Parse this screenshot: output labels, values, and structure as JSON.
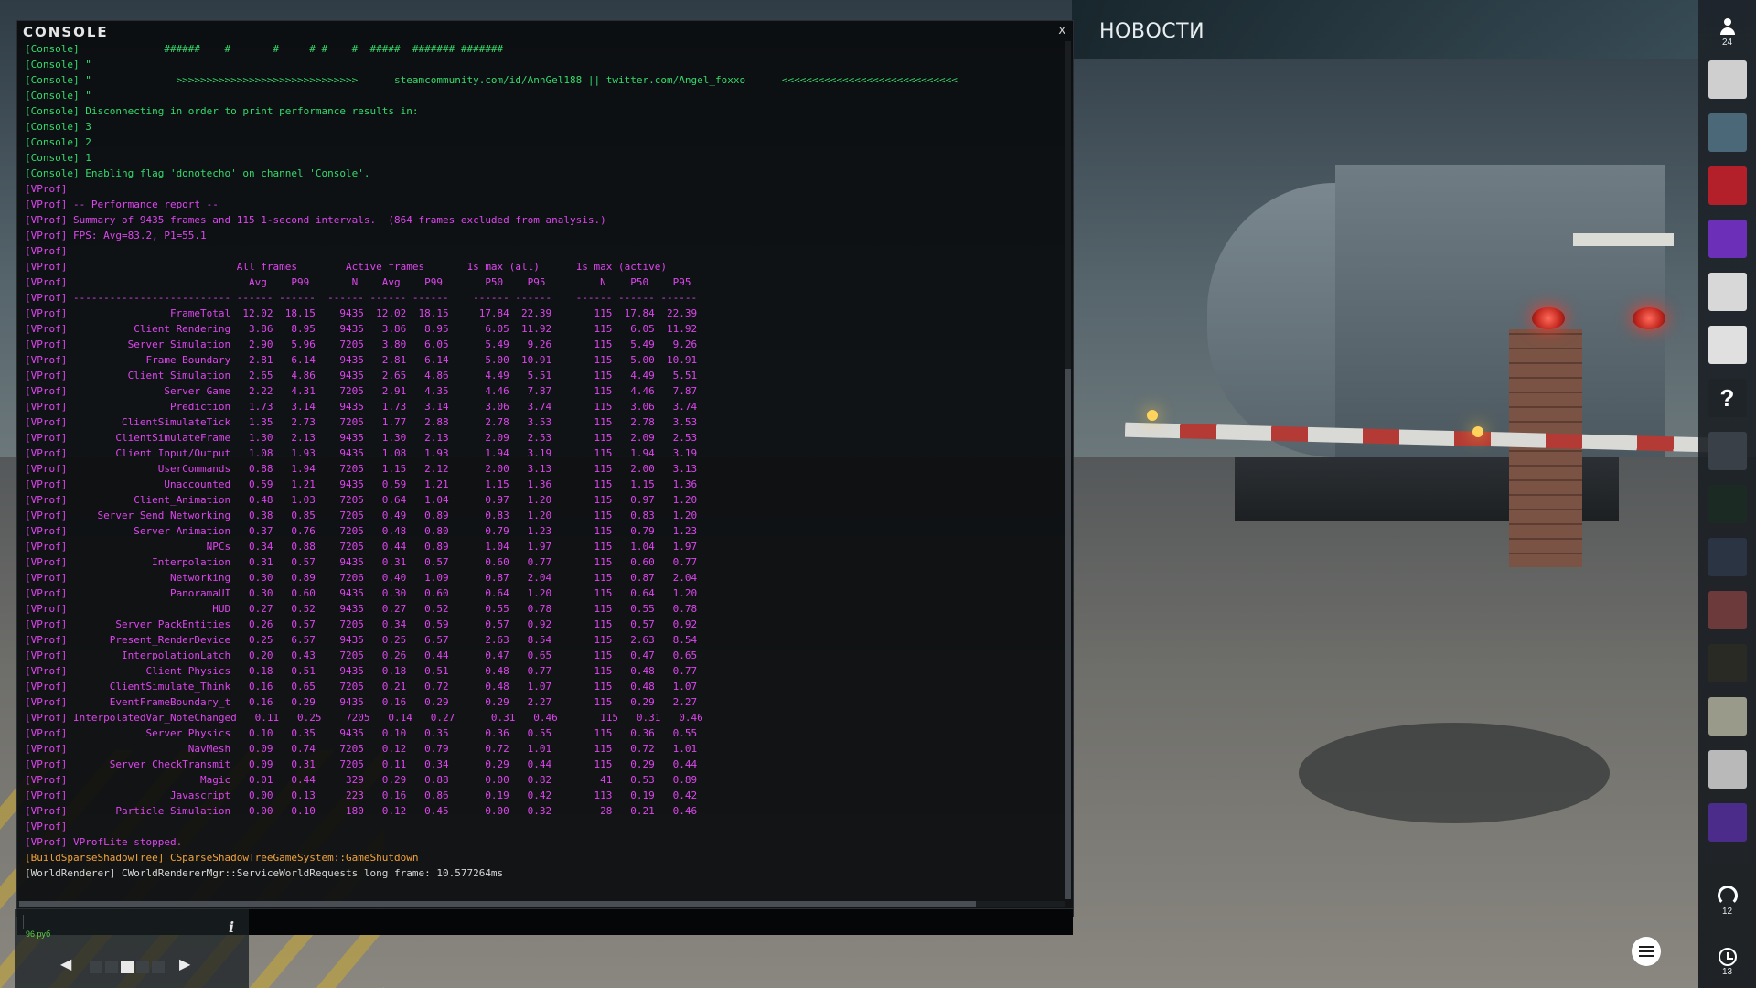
{
  "console": {
    "title": "CONSOLE",
    "close_label": "x",
    "input_value": "",
    "lines": [
      {
        "text": "[Console]              ######    #       #     # #    #  #####  ####### #######",
        "color": "green"
      },
      {
        "text": "[Console] \"",
        "color": "green"
      },
      {
        "text": "[Console] \"              >>>>>>>>>>>>>>>>>>>>>>>>>>>>>>      steamcommunity.com/id/AnnGel188 || twitter.com/Angel_foxxo      <<<<<<<<<<<<<<<<<<<<<<<<<<<<<",
        "color": "green"
      },
      {
        "text": "[Console] \"",
        "color": "green"
      },
      {
        "text": "[Console] Disconnecting in order to print performance results in:",
        "color": "green"
      },
      {
        "text": "[Console] 3",
        "color": "green"
      },
      {
        "text": "[Console] 2",
        "color": "green"
      },
      {
        "text": "[Console] 1",
        "color": "green"
      },
      {
        "text": "[Console] Enabling flag 'donotecho' on channel 'Console'.",
        "color": "green"
      },
      {
        "text": "[VProf]",
        "color": "magenta"
      },
      {
        "text": "[VProf] -- Performance report --",
        "color": "magenta"
      },
      {
        "text": "[VProf] Summary of 9435 frames and 115 1-second intervals.  (864 frames excluded from analysis.)",
        "color": "magenta"
      },
      {
        "text": "[VProf] FPS: Avg=83.2, P1=55.1",
        "color": "magenta"
      },
      {
        "text": "[VProf]",
        "color": "magenta"
      },
      {
        "text": "[VProf]                            All frames        Active frames       1s max (all)      1s max (active)",
        "color": "magenta"
      },
      {
        "text": "[VProf]                              Avg    P99       N    Avg    P99       P50    P95         N    P50    P95",
        "color": "magenta"
      },
      {
        "text": "[VProf] -------------------------- ------ ------  ------ ------ ------    ------ ------    ------ ------ ------",
        "color": "magenta"
      },
      {
        "text": "[VProf]                 FrameTotal  12.02  18.15    9435  12.02  18.15     17.84  22.39       115  17.84  22.39",
        "color": "magenta"
      },
      {
        "text": "[VProf]           Client Rendering   3.86   8.95    9435   3.86   8.95      6.05  11.92       115   6.05  11.92",
        "color": "magenta"
      },
      {
        "text": "[VProf]          Server Simulation   2.90   5.96    7205   3.80   6.05      5.49   9.26       115   5.49   9.26",
        "color": "magenta"
      },
      {
        "text": "[VProf]             Frame Boundary   2.81   6.14    9435   2.81   6.14      5.00  10.91       115   5.00  10.91",
        "color": "magenta"
      },
      {
        "text": "[VProf]          Client Simulation   2.65   4.86    9435   2.65   4.86      4.49   5.51       115   4.49   5.51",
        "color": "magenta"
      },
      {
        "text": "[VProf]                Server Game   2.22   4.31    7205   2.91   4.35      4.46   7.87       115   4.46   7.87",
        "color": "magenta"
      },
      {
        "text": "[VProf]                 Prediction   1.73   3.14    9435   1.73   3.14      3.06   3.74       115   3.06   3.74",
        "color": "magenta"
      },
      {
        "text": "[VProf]         ClientSimulateTick   1.35   2.73    7205   1.77   2.88      2.78   3.53       115   2.78   3.53",
        "color": "magenta"
      },
      {
        "text": "[VProf]        ClientSimulateFrame   1.30   2.13    9435   1.30   2.13      2.09   2.53       115   2.09   2.53",
        "color": "magenta"
      },
      {
        "text": "[VProf]        Client Input/Output   1.08   1.93    9435   1.08   1.93      1.94   3.19       115   1.94   3.19",
        "color": "magenta"
      },
      {
        "text": "[VProf]               UserCommands   0.88   1.94    7205   1.15   2.12      2.00   3.13       115   2.00   3.13",
        "color": "magenta"
      },
      {
        "text": "[VProf]                Unaccounted   0.59   1.21    9435   0.59   1.21      1.15   1.36       115   1.15   1.36",
        "color": "magenta"
      },
      {
        "text": "[VProf]           Client_Animation   0.48   1.03    7205   0.64   1.04      0.97   1.20       115   0.97   1.20",
        "color": "magenta"
      },
      {
        "text": "[VProf]     Server Send Networking   0.38   0.85    7205   0.49   0.89      0.83   1.20       115   0.83   1.20",
        "color": "magenta"
      },
      {
        "text": "[VProf]           Server Animation   0.37   0.76    7205   0.48   0.80      0.79   1.23       115   0.79   1.23",
        "color": "magenta"
      },
      {
        "text": "[VProf]                       NPCs   0.34   0.88    7205   0.44   0.89      1.04   1.97       115   1.04   1.97",
        "color": "magenta"
      },
      {
        "text": "[VProf]              Interpolation   0.31   0.57    9435   0.31   0.57      0.60   0.77       115   0.60   0.77",
        "color": "magenta"
      },
      {
        "text": "[VProf]                 Networking   0.30   0.89    7206   0.40   1.09      0.87   2.04       115   0.87   2.04",
        "color": "magenta"
      },
      {
        "text": "[VProf]                 PanoramaUI   0.30   0.60    9435   0.30   0.60      0.64   1.20       115   0.64   1.20",
        "color": "magenta"
      },
      {
        "text": "[VProf]                        HUD   0.27   0.52    9435   0.27   0.52      0.55   0.78       115   0.55   0.78",
        "color": "magenta"
      },
      {
        "text": "[VProf]        Server PackEntities   0.26   0.57    7205   0.34   0.59      0.57   0.92       115   0.57   0.92",
        "color": "magenta"
      },
      {
        "text": "[VProf]       Present_RenderDevice   0.25   6.57    9435   0.25   6.57      2.63   8.54       115   2.63   8.54",
        "color": "magenta"
      },
      {
        "text": "[VProf]         InterpolationLatch   0.20   0.43    7205   0.26   0.44      0.47   0.65       115   0.47   0.65",
        "color": "magenta"
      },
      {
        "text": "[VProf]             Client Physics   0.18   0.51    9435   0.18   0.51      0.48   0.77       115   0.48   0.77",
        "color": "magenta"
      },
      {
        "text": "[VProf]       ClientSimulate_Think   0.16   0.65    7205   0.21   0.72      0.48   1.07       115   0.48   1.07",
        "color": "magenta"
      },
      {
        "text": "[VProf]       EventFrameBoundary_t   0.16   0.29    9435   0.16   0.29      0.29   2.27       115   0.29   2.27",
        "color": "magenta"
      },
      {
        "text": "[VProf] InterpolatedVar_NoteChanged   0.11   0.25    7205   0.14   0.27      0.31   0.46       115   0.31   0.46",
        "color": "magenta"
      },
      {
        "text": "[VProf]             Server Physics   0.10   0.35    9435   0.10   0.35      0.36   0.55       115   0.36   0.55",
        "color": "magenta"
      },
      {
        "text": "[VProf]                    NavMesh   0.09   0.74    7205   0.12   0.79      0.72   1.01       115   0.72   1.01",
        "color": "magenta"
      },
      {
        "text": "[VProf]       Server CheckTransmit   0.09   0.31    7205   0.11   0.34      0.29   0.44       115   0.29   0.44",
        "color": "magenta"
      },
      {
        "text": "[VProf]                      Magic   0.01   0.44     329   0.29   0.88      0.00   0.82        41   0.53   0.89",
        "color": "magenta"
      },
      {
        "text": "[VProf]                 Javascript   0.00   0.13     223   0.16   0.86      0.19   0.42       113   0.19   0.42",
        "color": "magenta"
      },
      {
        "text": "[VProf]        Particle Simulation   0.00   0.10     180   0.12   0.45      0.00   0.32        28   0.21   0.46",
        "color": "magenta"
      },
      {
        "text": "[VProf]",
        "color": "magenta"
      },
      {
        "text": "[VProf] VProfLite stopped.",
        "color": "magenta"
      },
      {
        "text": "[BuildSparseShadowTree] CSparseShadowTreeGameSystem::GameShutdown",
        "color": "orange"
      },
      {
        "text": "[WorldRenderer] CWorldRendererMgr::ServiceWorldRequests long frame: 10.577264ms",
        "color": "white"
      }
    ]
  },
  "news": {
    "title": "НОВОСТИ"
  },
  "media_widget": {
    "text": "",
    "price": "96 руб",
    "info_icon": "info-icon",
    "prev_icon": "◀",
    "next_icon": "▶",
    "page_count": 5,
    "active_page": 3
  },
  "sidebar": {
    "friends_icon": "person-icon",
    "friends_count": "24",
    "avatars": [
      {
        "icon": "avatar-1",
        "color": "#cfcfcf",
        "selected": true
      },
      {
        "icon": "avatar-2",
        "color": "#4a6878"
      },
      {
        "icon": "avatar-3",
        "color": "#b3202a"
      },
      {
        "icon": "avatar-4",
        "color": "#6b2fb8"
      },
      {
        "icon": "avatar-5",
        "color": "#d8d8d8"
      },
      {
        "icon": "avatar-6",
        "color": "#e0e0e0"
      },
      {
        "icon": "avatar-unknown",
        "color": "#1f2428",
        "label": "?"
      },
      {
        "icon": "avatar-8",
        "color": "#3a4048"
      },
      {
        "icon": "avatar-9",
        "color": "#1c2a24"
      },
      {
        "icon": "avatar-10",
        "color": "#2b3442"
      },
      {
        "icon": "avatar-11",
        "color": "#6c3a3a"
      },
      {
        "icon": "avatar-12",
        "color": "#2a2a24"
      },
      {
        "icon": "avatar-13",
        "color": "#9a9a8a"
      },
      {
        "icon": "avatar-14",
        "color": "#b9b9b9"
      },
      {
        "icon": "avatar-15",
        "color": "#4b2c8a"
      }
    ],
    "broadcast_icon": "broadcast-icon",
    "broadcast_count": "12",
    "history_icon": "history-icon",
    "history_count": "13"
  },
  "settings_button": {
    "icon": "sliders-icon"
  }
}
